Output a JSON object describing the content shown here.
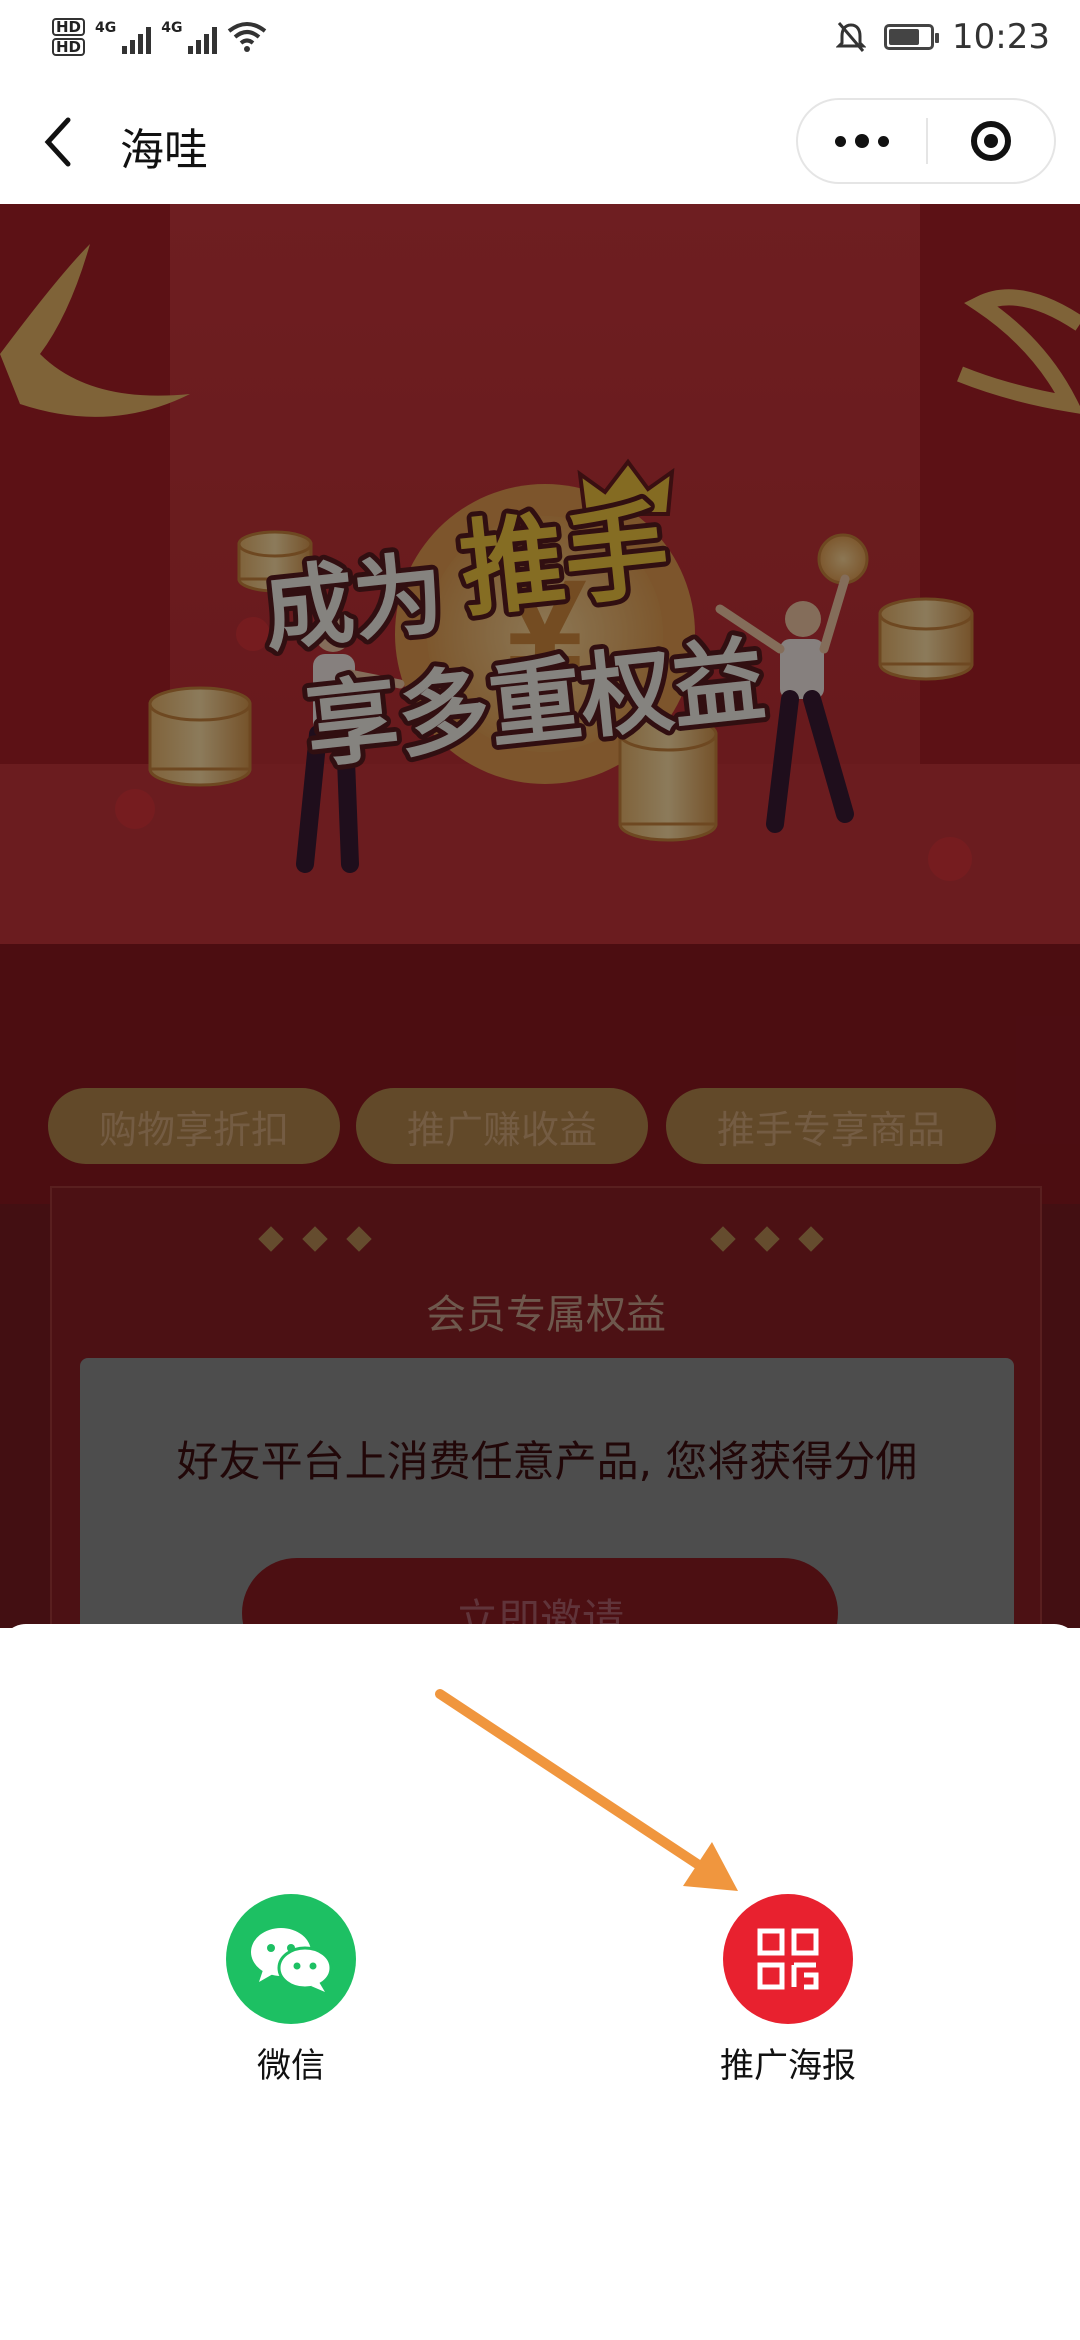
{
  "status_bar": {
    "time": "10:23",
    "network_1": "4G",
    "network_2": "4G",
    "hd_1": "HD",
    "hd_2": "HD",
    "battery_fraction": 0.75
  },
  "nav": {
    "title": "海哇"
  },
  "banner": {
    "line1_a": "成为",
    "line1_b": "推手",
    "line2": "享多重权益",
    "currency": "¥"
  },
  "tabs": [
    {
      "label": "购物享折扣"
    },
    {
      "label": "推广赚收益"
    },
    {
      "label": "推手专享商品"
    }
  ],
  "card": {
    "title": "会员专属权益",
    "description": "好友平台上消费任意产品, 您将获得分佣",
    "button_label": "立即邀请"
  },
  "share_sheet": {
    "items": [
      {
        "label": "微信",
        "color": "#1dc063",
        "icon": "wechat-icon"
      },
      {
        "label": "推广海报",
        "color": "#e8212f",
        "icon": "qr-code-icon"
      }
    ],
    "arrow_color": "#f0963e"
  }
}
